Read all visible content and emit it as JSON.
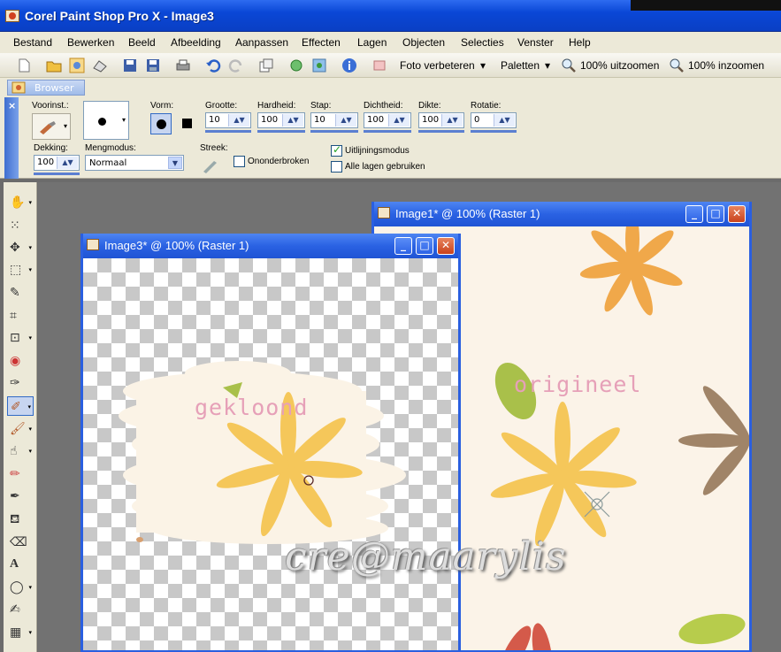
{
  "app": {
    "title": "Corel Paint Shop Pro X - Image3"
  },
  "menu": [
    "Bestand",
    "Bewerken",
    "Beeld",
    "Afbeelding",
    "Aanpassen",
    "Effecten",
    "Lagen",
    "Objecten",
    "Selecties",
    "Venster",
    "Help"
  ],
  "toolbar": {
    "photo_fix": "Foto verbeteren",
    "palettes": "Paletten",
    "zoom_out": "100% uitzoomen",
    "zoom_in": "100% inzoomen"
  },
  "browser_tab": "Browser",
  "options": {
    "preset_label": "Voorinst.:",
    "shape_label": "Vorm:",
    "size_label": "Grootte:",
    "size_value": "10",
    "hardness_label": "Hardheid:",
    "hardness_value": "100",
    "step_label": "Stap:",
    "step_value": "10",
    "density_label": "Dichtheid:",
    "density_value": "100",
    "thickness_label": "Dikte:",
    "thickness_value": "100",
    "rotation_label": "Rotatie:",
    "rotation_value": "0",
    "opacity_label": "Dekking:",
    "opacity_value": "100",
    "blend_label": "Mengmodus:",
    "blend_value": "Normaal",
    "stroke_label": "Streek:",
    "continuous_label": "Ononderbroken",
    "aligned_label": "Uitlijningsmodus",
    "all_layers_label": "Alle lagen gebruiken"
  },
  "windows": {
    "image1_title": "Image1* @ 100% (Raster 1)",
    "image3_title": "Image3* @ 100% (Raster 1)"
  },
  "canvas_text": {
    "original": "origineel",
    "cloned": "gekloond",
    "watermark": "cre@maarylis"
  }
}
